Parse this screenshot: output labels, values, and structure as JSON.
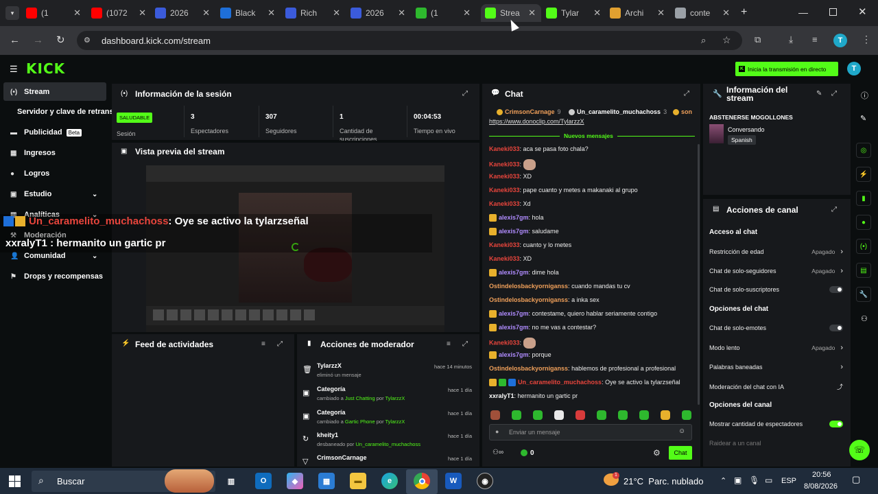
{
  "browser": {
    "tabs": [
      {
        "label": "(1",
        "icon": "youtube-icon",
        "color": "#ff0000"
      },
      {
        "label": "(1072",
        "icon": "youtube-icon",
        "color": "#ff0000"
      },
      {
        "label": "2026",
        "icon": "zm-icon",
        "color": "#3b5bdb"
      },
      {
        "label": "Black",
        "icon": "a-icon",
        "color": "#1e6fd9"
      },
      {
        "label": "Rich",
        "icon": "zm-icon",
        "color": "#3b5bdb"
      },
      {
        "label": "2026",
        "icon": "zm-icon",
        "color": "#3b5bdb"
      },
      {
        "label": "(1",
        "icon": "chat-icon",
        "color": "#2eb82e"
      },
      {
        "label": "Strea",
        "icon": "kick-icon",
        "color": "#53fc18"
      },
      {
        "label": "Tylar",
        "icon": "kick-icon",
        "color": "#53fc18"
      },
      {
        "label": "Archi",
        "icon": "archive-icon",
        "color": "#e0a030"
      },
      {
        "label": "conte",
        "icon": "globe-icon",
        "color": "#9aa0a6"
      }
    ],
    "url": "dashboard.kick.com/stream",
    "profile_initial": "T"
  },
  "kick": {
    "logo": "KICK",
    "go_live_label": "Inicia la transmisión en directo",
    "avatar_initial": "T"
  },
  "sidebar": {
    "items": [
      {
        "label": "Stream",
        "icon": "stream-icon"
      },
      {
        "label": "Servidor y clave de retransm",
        "icon": ""
      },
      {
        "label": "Publicidad",
        "icon": "ads-icon",
        "badge": "Beta"
      },
      {
        "label": "Ingresos",
        "icon": "income-icon"
      },
      {
        "label": "Logros",
        "icon": "trophy-icon"
      },
      {
        "label": "Estudio",
        "icon": "studio-icon"
      },
      {
        "label": "Analíticas",
        "icon": "analytics-icon"
      },
      {
        "label": "Moderación",
        "icon": "moderation-icon"
      },
      {
        "label": "Comunidad",
        "icon": "community-icon"
      },
      {
        "label": "Drops y recompensas",
        "icon": "drops-icon"
      }
    ]
  },
  "session": {
    "title": "Información de la sesión",
    "status_badge": "SALUDABLE",
    "status_label": "Sesión",
    "stats": [
      {
        "value": "3",
        "label": "Espectadores"
      },
      {
        "value": "307",
        "label": "Seguidores"
      },
      {
        "value": "1",
        "label": "Cantidad de suscripciones"
      },
      {
        "value": "00:04:53",
        "label": "Tiempo en vivo"
      }
    ]
  },
  "preview": {
    "title": "Vista previa del stream"
  },
  "overlay": {
    "line1_user": "Un_caramelito_muchachoss",
    "line1_msg": ": Oye se activo la tylarzseñal",
    "line2_user": "xxralyT1",
    "line2_msg": ": hermanito un gartic pr"
  },
  "activity": {
    "title": "Feed de actividades"
  },
  "mod_actions": {
    "title": "Acciones de moderador",
    "items": [
      {
        "name": "TylarzzX",
        "detail_pre": "eliminó un mensaje",
        "detail_link": "",
        "detail_mid": "",
        "detail_user": "",
        "time": "hace 14 minutos",
        "icon": "trash-icon"
      },
      {
        "name": "Categoría",
        "detail_pre": "cambiado a ",
        "detail_link": "Just Chatting",
        "detail_mid": " por ",
        "detail_user": "TylarzzX",
        "time": "hace 1 día",
        "icon": "category-icon"
      },
      {
        "name": "Categoría",
        "detail_pre": "cambiado a ",
        "detail_link": "Gartic Phone",
        "detail_mid": " por ",
        "detail_user": "TylarzzX",
        "time": "hace 1 día",
        "icon": "category-icon"
      },
      {
        "name": "kheity1",
        "detail_pre": "desbaneado por ",
        "detail_link": "Un_caramelito_muchachoss",
        "detail_mid": "",
        "detail_user": "",
        "time": "hace 1 día",
        "icon": "unban-icon"
      },
      {
        "name": "CrimsonCarnage",
        "detail_pre": "",
        "detail_link": "",
        "detail_mid": "",
        "detail_user": "",
        "time": "hace 1 día",
        "icon": "filter-icon"
      }
    ]
  },
  "chat": {
    "title": "Chat",
    "pinned": [
      {
        "name": "CrimsonCarnage",
        "count": "9"
      },
      {
        "name": "Un_caramelito_muchachoss",
        "count": "3"
      },
      {
        "name": "son",
        "count": ""
      }
    ],
    "link": "https://www.donoclip.com/TylarzzX",
    "new_messages": "Nuevos mensajes",
    "messages": [
      {
        "user": "Kaneki033",
        "msg": "aca se pasa foto chala?",
        "color": "red",
        "badge": false,
        "emote": false
      },
      {
        "user": "Kaneki033",
        "msg": "",
        "color": "red",
        "badge": false,
        "emote": true
      },
      {
        "user": "Kaneki033",
        "msg": "XD",
        "color": "red",
        "badge": false,
        "emote": false
      },
      {
        "user": "Kaneki033",
        "msg": "pape cuanto y metes a makanaki al grupo",
        "color": "red",
        "badge": false,
        "emote": false
      },
      {
        "user": "Kaneki033",
        "msg": "Xd",
        "color": "red",
        "badge": false,
        "emote": false
      },
      {
        "user": "alexis7gm",
        "msg": "hola",
        "color": "purple",
        "badge": true,
        "emote": false
      },
      {
        "user": "alexis7gm",
        "msg": "saludame",
        "color": "purple",
        "badge": true,
        "emote": false
      },
      {
        "user": "Kaneki033",
        "msg": "cuanto y lo metes",
        "color": "red",
        "badge": false,
        "emote": false
      },
      {
        "user": "Kaneki033",
        "msg": "XD",
        "color": "red",
        "badge": false,
        "emote": false
      },
      {
        "user": "alexis7gm",
        "msg": "dime hola",
        "color": "purple",
        "badge": true,
        "emote": false
      },
      {
        "user": "Ostindelosbackyorniganss",
        "msg": "cuando mandas tu cv",
        "color": "orange",
        "badge": false,
        "emote": false
      },
      {
        "user": "Ostindelosbackyorniganss",
        "msg": "a inka sex",
        "color": "orange",
        "badge": false,
        "emote": false
      },
      {
        "user": "alexis7gm",
        "msg": "contestame, quiero hablar seriamente contigo",
        "color": "purple",
        "badge": true,
        "emote": false
      },
      {
        "user": "alexis7gm",
        "msg": "no me vas a contestar?",
        "color": "purple",
        "badge": true,
        "emote": false
      },
      {
        "user": "Kaneki033",
        "msg": "",
        "color": "red",
        "badge": false,
        "emote": true
      },
      {
        "user": "alexis7gm",
        "msg": "porque",
        "color": "purple",
        "badge": true,
        "emote": false
      },
      {
        "user": "Ostindelosbackyorniganss",
        "msg": "hablemos de profesional a profesional",
        "color": "orange",
        "badge": false,
        "emote": false
      },
      {
        "user": "Un_caramelito_muchachoss",
        "msg": "Oye se activo la tylarzseñal",
        "color": "red",
        "badge": true,
        "emote": false
      },
      {
        "user": "xxralyT1",
        "msg": "hermanito un gartic pr",
        "color": "white",
        "badge": false,
        "emote": false
      }
    ],
    "input_placeholder": "Enviar un mensaje",
    "points": "0",
    "send_label": "Chat"
  },
  "stream_info": {
    "title": "Información del stream",
    "stream_title": "ABSTENERSE MOGOLLONES",
    "category": "Conversando",
    "language": "Spanish"
  },
  "channel_actions": {
    "title": "Acciones de canal",
    "sections": [
      {
        "heading": "Acceso al chat",
        "rows": [
          {
            "label": "Restricción de edad",
            "value": "Apagado",
            "kind": "chevron"
          },
          {
            "label": "Chat de solo-seguidores",
            "value": "Apagado",
            "kind": "chevron"
          },
          {
            "label": "Chat de solo-suscriptores",
            "value": "",
            "kind": "toggle-off"
          }
        ]
      },
      {
        "heading": "Opciones del chat",
        "rows": [
          {
            "label": "Chat de solo-emotes",
            "value": "",
            "kind": "toggle-off"
          },
          {
            "label": "Modo lento",
            "value": "Apagado",
            "kind": "chevron"
          },
          {
            "label": "Palabras baneadas",
            "value": "",
            "kind": "chevron"
          },
          {
            "label": "Moderación del chat con IA",
            "value": "",
            "kind": "external"
          }
        ]
      },
      {
        "heading": "Opciones del canal",
        "rows": [
          {
            "label": "Mostrar cantidad de espectadores",
            "value": "",
            "kind": "toggle-on"
          },
          {
            "label": "Raidear a un canal",
            "value": "",
            "kind": "none"
          }
        ]
      }
    ]
  },
  "taskbar": {
    "search_placeholder": "Buscar",
    "weather": "21°C  Parc. nublado",
    "lang": "ESP",
    "time": "20:56",
    "date": "8/08/2026",
    "notif_count": "1"
  },
  "colors": {
    "kick_green": "#53fc18",
    "panel": "#17191c",
    "bg": "#0b0e0f"
  }
}
